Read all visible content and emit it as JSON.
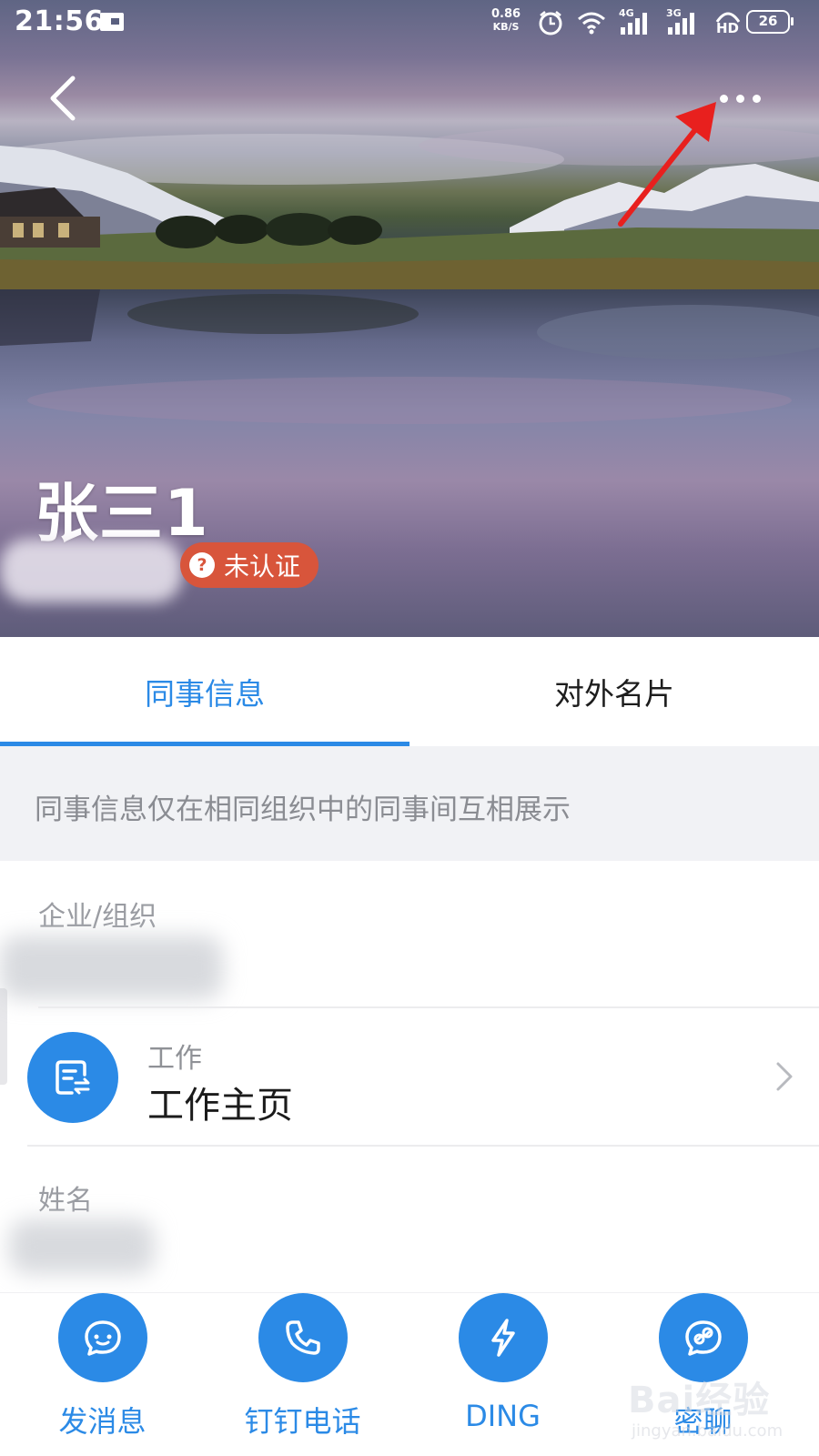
{
  "status_bar": {
    "time": "21:56",
    "speed_value": "0.86",
    "speed_unit": "KB/S",
    "network_1": "4G",
    "network_2": "3G",
    "hd_label": "HD",
    "battery": "26"
  },
  "header": {
    "profile_name": "张三1",
    "verify_badge_label": "未认证",
    "verify_badge_icon": "?"
  },
  "tabs": [
    {
      "label": "同事信息",
      "selected": true
    },
    {
      "label": "对外名片",
      "selected": false
    }
  ],
  "notice": "同事信息仅在相同组织中的同事间互相展示",
  "org": {
    "label": "企业/组织"
  },
  "work": {
    "small_label": "工作",
    "title": "工作主页"
  },
  "name_field": {
    "label": "姓名"
  },
  "actions": [
    {
      "label": "发消息",
      "icon": "chat-icon"
    },
    {
      "label": "钉钉电话",
      "icon": "phone-icon"
    },
    {
      "label": "DING",
      "icon": "lightning-icon"
    },
    {
      "label": "密聊",
      "icon": "secret-chat-icon"
    }
  ],
  "watermark": {
    "main": "Bai经验",
    "sub": "jingyan.baidu.com"
  },
  "colors": {
    "accent": "#2b8ae6",
    "badge": "#d8553b",
    "annotation": "#e8201e"
  }
}
